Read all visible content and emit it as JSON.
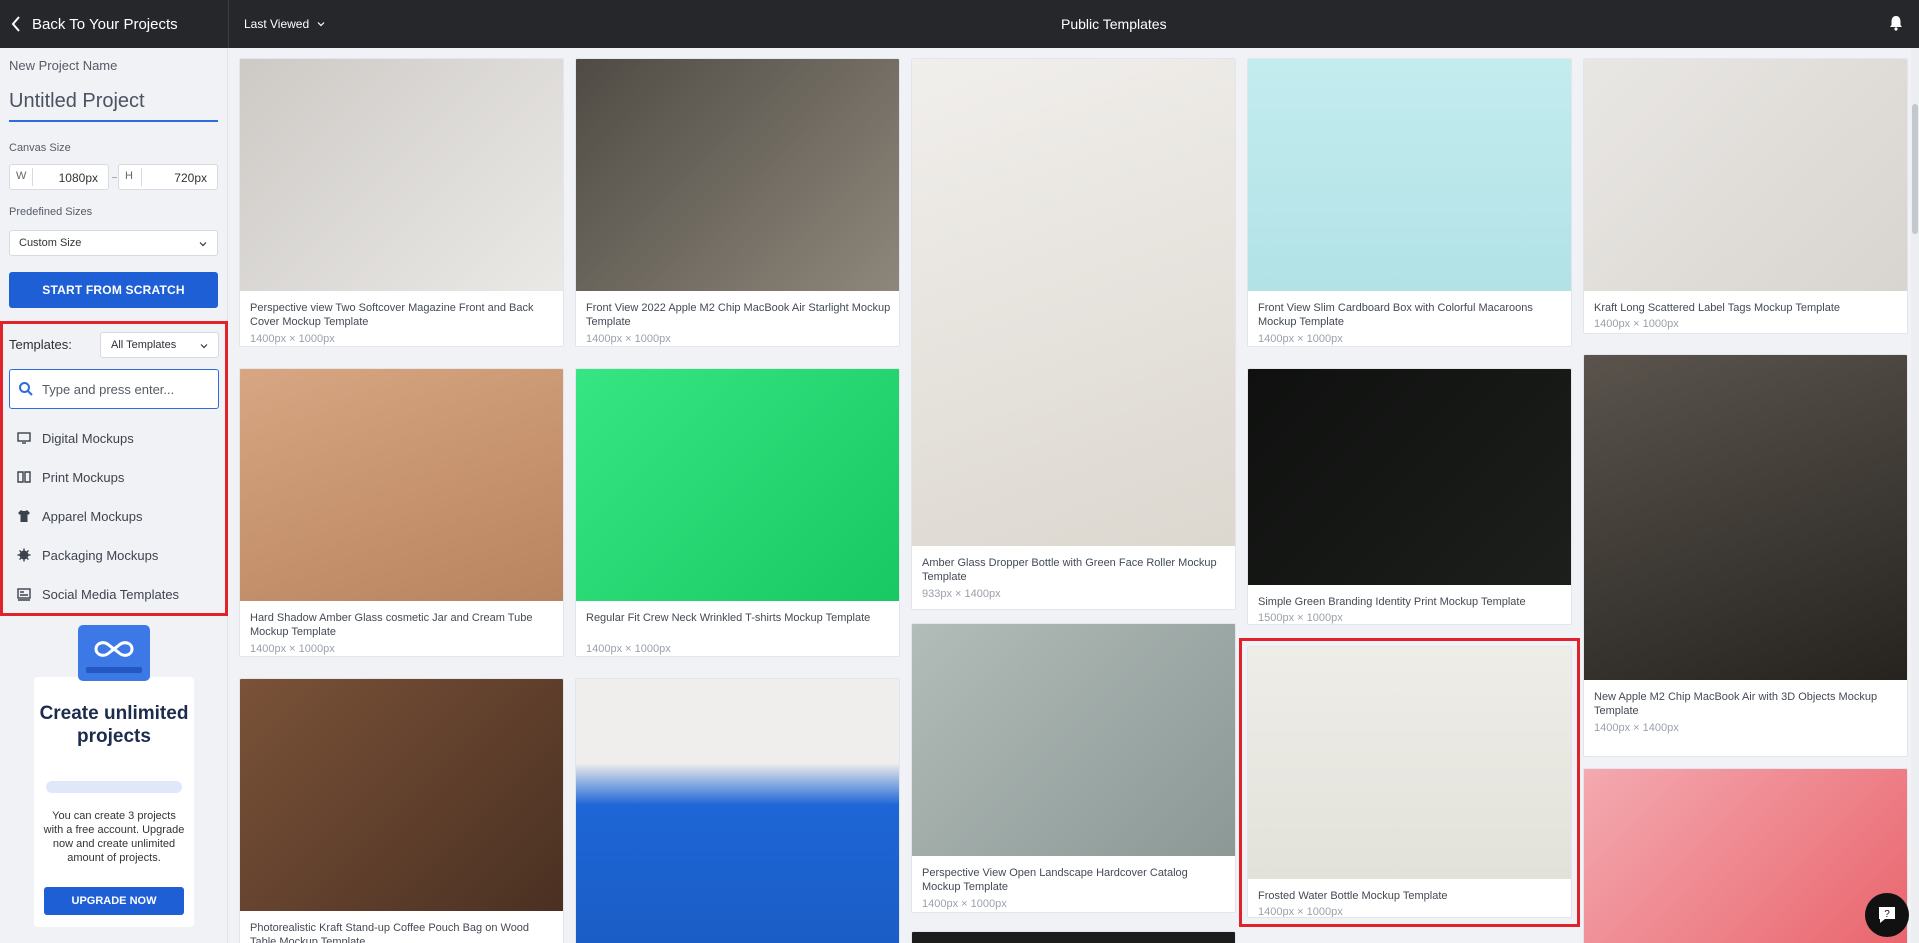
{
  "header": {
    "back_label": "Back To Your Projects",
    "sort_label": "Last Viewed",
    "page_title": "Public Templates"
  },
  "sidebar": {
    "project_name_label": "New Project Name",
    "project_name_value": "Untitled Project",
    "canvas_size_label": "Canvas Size",
    "width_key": "W",
    "width_value": "1080px",
    "height_key": "H",
    "height_value": "720px",
    "predefined_label": "Predefined Sizes",
    "predefined_value": "Custom Size",
    "start_button": "START FROM SCRATCH",
    "templates_label": "Templates:",
    "templates_filter": "All Templates",
    "search_placeholder": "Type and press enter...",
    "categories": [
      {
        "label": "Digital Mockups",
        "icon": "monitor-icon"
      },
      {
        "label": "Print Mockups",
        "icon": "book-icon"
      },
      {
        "label": "Apparel Mockups",
        "icon": "shirt-icon"
      },
      {
        "label": "Packaging Mockups",
        "icon": "package-icon"
      },
      {
        "label": "Social Media Templates",
        "icon": "social-icon"
      }
    ]
  },
  "promo": {
    "title": "Create unlimited projects",
    "text": "You can create 3 projects with a free account. Upgrade now and create unlimited amount of projects.",
    "button": "UPGRADE NOW"
  },
  "templates": [
    {
      "title": "Perspective view Two Softcover Magazine Front and Back Cover Mockup Template",
      "size": "1400px × 1000px",
      "bg": "#dedcd8"
    },
    {
      "title": "Front View 2022 Apple M2 Chip MacBook Air Starlight Mockup Template",
      "size": "1400px × 1000px",
      "bg": "#6c6860"
    },
    {
      "title": "Amber Glass Dropper Bottle with Green Face Roller Mockup Template",
      "size": "933px × 1400px",
      "bg": "#ebe8e3"
    },
    {
      "title": "Front View Slim Cardboard Box with Colorful Macaroons Mockup Template",
      "size": "1400px × 1000px",
      "bg": "#bfe8ea"
    },
    {
      "title": "Kraft Long Scattered Label Tags Mockup Template",
      "size": "1400px × 1000px",
      "bg": "#ecebea"
    },
    {
      "title": "Hard Shadow Amber Glass cosmetic Jar and Cream Tube Mockup Template",
      "size": "1400px × 1000px",
      "bg": "#c99a76"
    },
    {
      "title": "Regular Fit Crew Neck Wrinkled T-shirts Mockup Template",
      "size": "1400px × 1000px",
      "bg": "#2ee27a"
    },
    {
      "title": "Simple Green Branding Identity Print Mockup Template",
      "size": "1500px × 1000px",
      "bg": "#121412"
    },
    {
      "title": "New Apple M2 Chip MacBook Air with 3D Objects Mockup Template",
      "size": "1400px × 1400px",
      "bg": "#3a3632"
    },
    {
      "title": "Perspective View Open Landscape Hardcover Catalog Mockup Template",
      "size": "1400px × 1000px",
      "bg": "#9aa7a4"
    },
    {
      "title": "Frosted Water Bottle Mockup Template",
      "size": "1400px × 1000px",
      "bg": "#eae9e2"
    },
    {
      "title": "Photorealistic Kraft Stand-up Coffee Pouch Bag on Wood Table Mockup Template",
      "size": "",
      "bg": "#5a3c2a"
    },
    {
      "title": "",
      "size": "",
      "bg": "#f0eeec"
    },
    {
      "title": "",
      "size": "",
      "bg": "#eb6c73"
    },
    {
      "title": "",
      "size": "",
      "bg": "#222222"
    }
  ],
  "colors": {
    "accent": "#1e5fd6",
    "highlight": "#e0222a",
    "topbar": "#25272b"
  }
}
